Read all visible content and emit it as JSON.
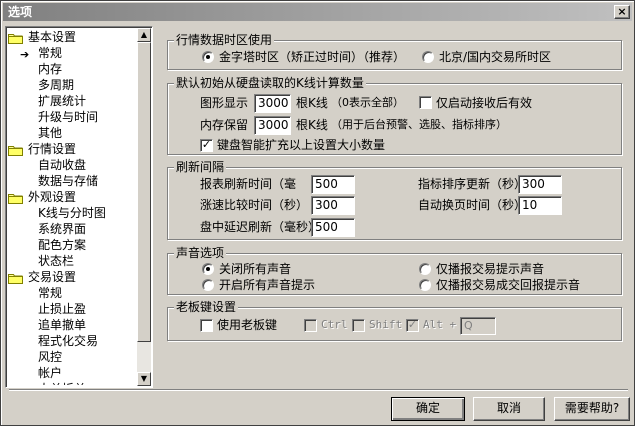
{
  "window": {
    "title": "选项",
    "close": "×"
  },
  "tree": {
    "items": [
      {
        "label": "基本设置",
        "type": "parent"
      },
      {
        "label": "常规",
        "type": "child",
        "selected": true
      },
      {
        "label": "内存",
        "type": "child"
      },
      {
        "label": "多周期",
        "type": "child"
      },
      {
        "label": "扩展统计",
        "type": "child"
      },
      {
        "label": "升级与时间",
        "type": "child"
      },
      {
        "label": "其他",
        "type": "child"
      },
      {
        "label": "行情设置",
        "type": "parent"
      },
      {
        "label": "自动收盘",
        "type": "child"
      },
      {
        "label": "数据与存储",
        "type": "child"
      },
      {
        "label": "外观设置",
        "type": "parent"
      },
      {
        "label": "K线与分时图",
        "type": "child"
      },
      {
        "label": "系统界面",
        "type": "child"
      },
      {
        "label": "配色方案",
        "type": "child"
      },
      {
        "label": "状态栏",
        "type": "child"
      },
      {
        "label": "交易设置",
        "type": "parent"
      },
      {
        "label": "常规",
        "type": "child"
      },
      {
        "label": "止损止盈",
        "type": "child"
      },
      {
        "label": "追单撤单",
        "type": "child"
      },
      {
        "label": "程式化交易",
        "type": "child"
      },
      {
        "label": "风控",
        "type": "child"
      },
      {
        "label": "帐户",
        "type": "child"
      },
      {
        "label": "大单拆单",
        "type": "child"
      }
    ]
  },
  "timezone": {
    "title": "行情数据时区使用",
    "opt1": "金字塔时区（矫正过时间）（推荐）",
    "opt2": "北京/国内交易所时区"
  },
  "kline": {
    "title": "默认初始从硬盘读取的K线计算数量",
    "display_label": "图形显示",
    "display_value": "3000",
    "display_unit": "根K线",
    "display_note": "（0表示全部）",
    "only_after_start": "仅启动接收后有效",
    "memory_label": "内存保留",
    "memory_value": "3000",
    "memory_unit": "根K线",
    "memory_note": "（用于后台预警、选股、指标排序）",
    "keyboard_check": "键盘智能扩充以上设置大小数量"
  },
  "refresh": {
    "title": "刷新间隔",
    "report_label": "报表刷新时间（毫",
    "report_value": "500",
    "indicator_label": "指标排序更新（秒）",
    "indicator_value": "300",
    "speed_label": "涨速比较时间（秒）",
    "speed_value": "300",
    "autopage_label": "自动换页时间（秒）",
    "autopage_value": "10",
    "delay_label": "盘中延迟刷新（毫秒）",
    "delay_value": "500"
  },
  "sound": {
    "title": "声音选项",
    "opt_off": "关闭所有声音",
    "opt_trade": "仅播报交易提示声音",
    "opt_on": "开启所有声音提示",
    "opt_trade_report": "仅播报交易成交回报提示音"
  },
  "boss": {
    "title": "老板键设置",
    "use": "使用老板键",
    "ctrl": "Ctrl",
    "shift": "Shift",
    "alt": "Alt +",
    "key_value": "Q"
  },
  "buttons": {
    "ok": "确定",
    "cancel": "取消",
    "help": "需要帮助?"
  }
}
